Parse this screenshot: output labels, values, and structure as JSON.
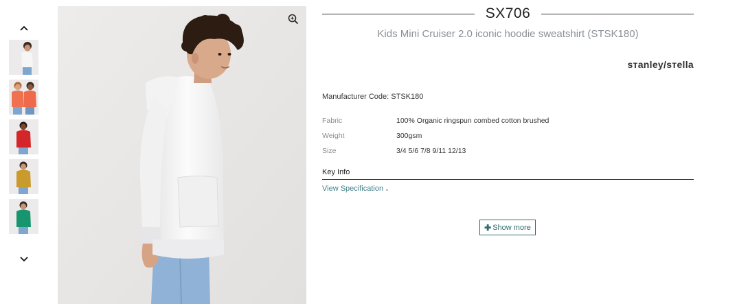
{
  "gallery": {
    "thumbnails": [
      {
        "color_name": "white",
        "hoodie_color": "#f6f6f6"
      },
      {
        "color_name": "coral",
        "hoodie_color": "#f07150"
      },
      {
        "color_name": "red",
        "hoodie_color": "#d3262b"
      },
      {
        "color_name": "ochre",
        "hoodie_color": "#c99a2c"
      },
      {
        "color_name": "green",
        "hoodie_color": "#17956e"
      }
    ]
  },
  "product": {
    "sku": "SX706",
    "title": "Kids Mini Cruiser 2.0 iconic hoodie sweatshirt (STSK180)",
    "brand": "sтanley/sтella",
    "manufacturer_code": "Manufacturer Code: STSK180",
    "specs": [
      {
        "label": "Fabric",
        "value": "100% Organic ringspun combed cotton brushed"
      },
      {
        "label": "Weight",
        "value": "300gsm"
      },
      {
        "label": "Size",
        "value": "3/4 5/6 7/8 9/11 12/13"
      }
    ],
    "key_info": "Key Info",
    "view_spec": "View Specification",
    "show_more": "Show more"
  },
  "colors": {
    "accent": "#2e6b72",
    "link": "#3f7f86",
    "muted": "#8a9096"
  }
}
